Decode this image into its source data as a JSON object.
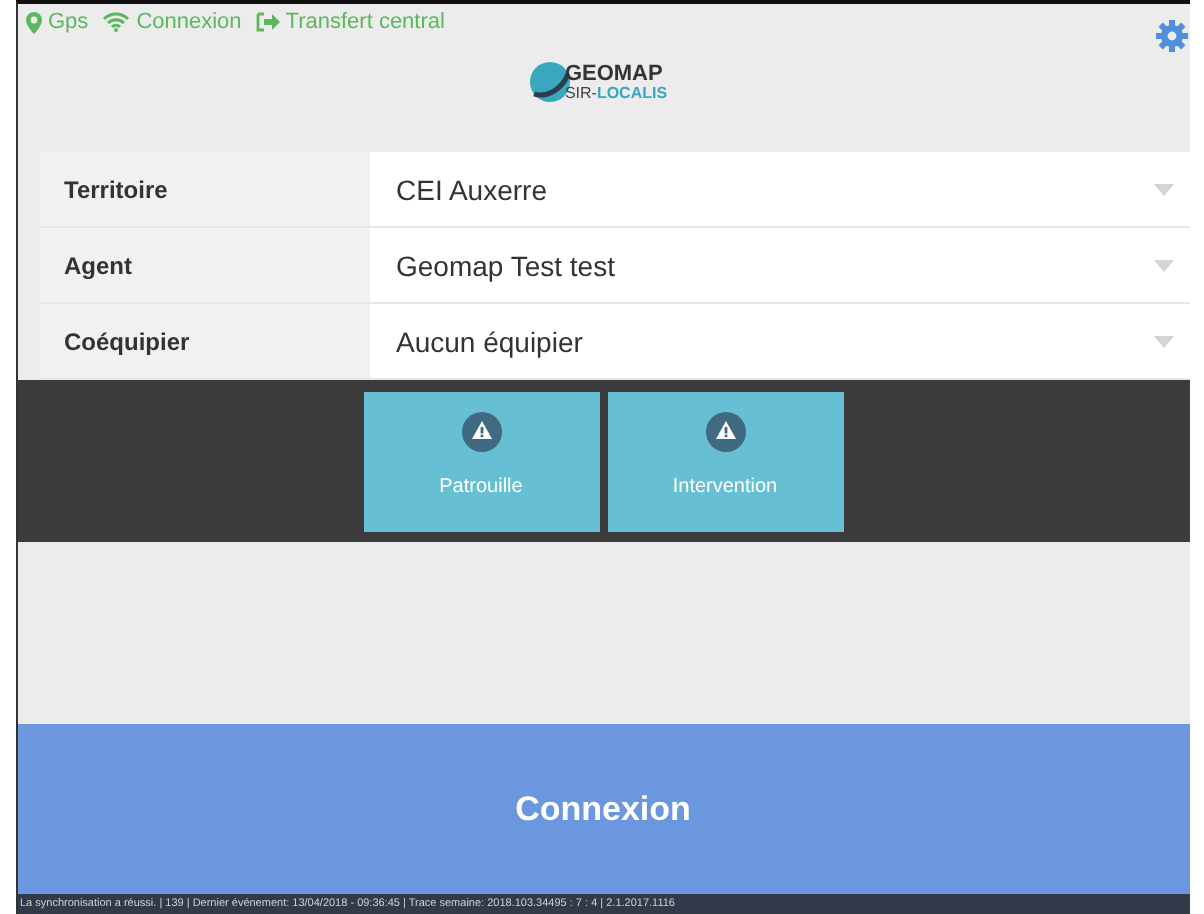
{
  "status_indicators": [
    {
      "kind": "gps",
      "label": "Gps"
    },
    {
      "kind": "wifi",
      "label": "Connexion"
    },
    {
      "kind": "transfer",
      "label": "Transfert central"
    }
  ],
  "logo": {
    "name": "GEOMAP",
    "sub_prefix": "SIR-",
    "sub_suffix": "LOCALIS"
  },
  "form": [
    {
      "label": "Territoire",
      "value": "CEI Auxerre"
    },
    {
      "label": "Agent",
      "value": "Geomap Test test"
    },
    {
      "label": "Coéquipier",
      "value": "Aucun équipier"
    }
  ],
  "actions": [
    {
      "label": "Patrouille"
    },
    {
      "label": "Intervention"
    }
  ],
  "connect_button": "Connexion",
  "status_bar": "La synchronisation a réussi. | 139 | Dernier événement: 13/04/2018 - 09:36:45 | Trace semaine: 2018.103.34495 : 7 : 4 | 2.1.2017.1116"
}
